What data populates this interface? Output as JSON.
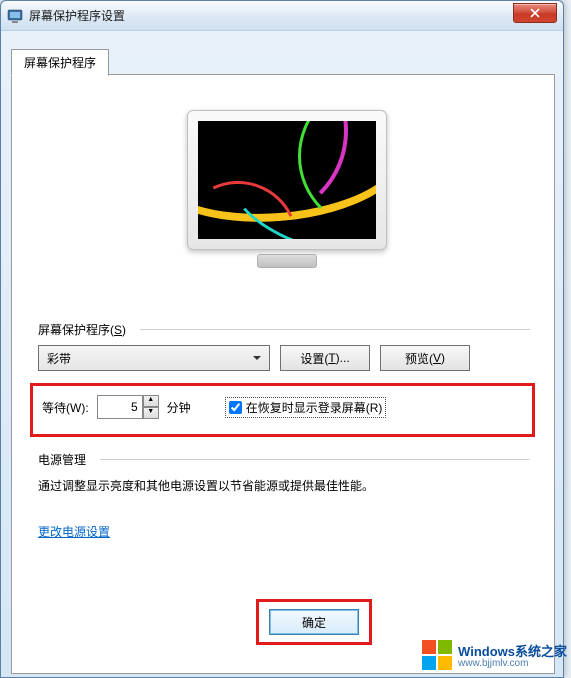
{
  "window": {
    "title": "屏幕保护程序设置",
    "close_label": "X"
  },
  "tab": {
    "label": "屏幕保护程序"
  },
  "screensaver": {
    "group_label_pre": "屏幕保护程序(",
    "group_label_key": "S",
    "group_label_post": ")",
    "selected": "彩带",
    "settings_btn_pre": "设置(",
    "settings_btn_key": "T",
    "settings_btn_post": ")...",
    "preview_btn_pre": "预览(",
    "preview_btn_key": "V",
    "preview_btn_post": ")"
  },
  "wait": {
    "label_pre": "等待(",
    "label_key": "W",
    "label_post": "):",
    "value": "5",
    "unit": "分钟",
    "resume_checked": true,
    "resume_label_pre": "在恢复时显示登录屏幕(",
    "resume_label_key": "R",
    "resume_label_post": ")"
  },
  "power": {
    "group_label": "电源管理",
    "description": "通过调整显示亮度和其他电源设置以节省能源或提供最佳性能。",
    "link": "更改电源设置"
  },
  "buttons": {
    "ok": "确定"
  },
  "watermark": {
    "brand_cn": "Windows",
    "brand_suffix": "系统之家",
    "url": "www.bjjmlv.com"
  }
}
